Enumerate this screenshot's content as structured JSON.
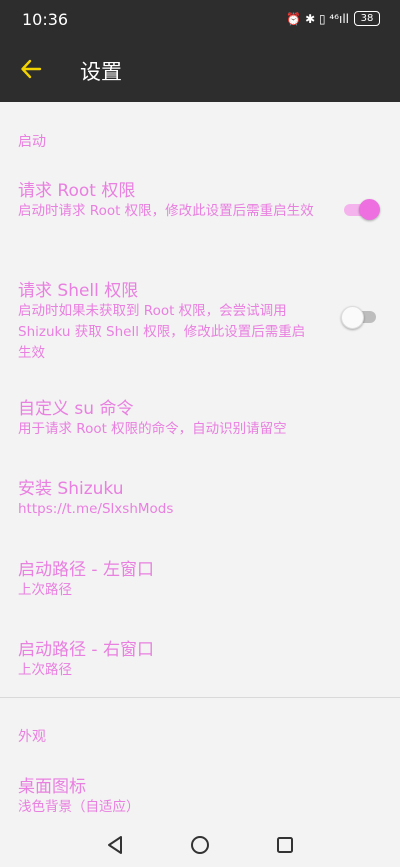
{
  "status_bar": {
    "time": "10:36",
    "icons_text": "⏰ ✱ ▯ ⁴⁶ıll",
    "battery": "38"
  },
  "app_bar": {
    "title": "设置",
    "back_icon": "arrow-left-icon",
    "accent": "#f2d200"
  },
  "colors": {
    "accent": "#e97fe0",
    "background": "#f3f3f3",
    "bar": "#2d2d2d"
  },
  "sections": {
    "startup": {
      "header": "启动",
      "request_root": {
        "title": "请求 Root 权限",
        "summary": "启动时请求 Root 权限，修改此设置后需重启生效",
        "enabled": true
      },
      "request_shell": {
        "title": "请求 Shell 权限",
        "summary": "启动时如果未获取到 Root 权限，会尝试调用 Shizuku 获取 Shell 权限，修改此设置后需重启生效",
        "enabled": false
      },
      "custom_su": {
        "title": "自定义 su 命令",
        "summary": "用于请求 Root 权限的命令，自动识别请留空"
      },
      "install_shizuku": {
        "title": "安装 Shizuku",
        "summary": "https://t.me/SlxshMods"
      },
      "left_path": {
        "title": "启动路径 - 左窗口",
        "summary": "上次路径"
      },
      "right_path": {
        "title": "启动路径 - 右窗口",
        "summary": "上次路径"
      }
    },
    "appearance": {
      "header": "外观",
      "desktop_icon": {
        "title": "桌面图标",
        "summary": "浅色背景（自适应）"
      }
    }
  },
  "nav_bar": {
    "back": "triangle-back-icon",
    "home": "circle-home-icon",
    "recents": "square-recents-icon"
  }
}
